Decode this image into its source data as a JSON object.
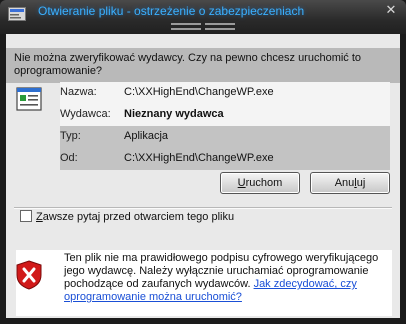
{
  "window": {
    "title": "Otwieranie pliku - ostrzeżenie o zabezpieczeniach",
    "close_label": "✕"
  },
  "question": "Nie można zweryfikować wydawcy. Czy na pewno chcesz uruchomić to oprogramowanie?",
  "file_info": [
    {
      "label": "Nazwa:",
      "value": "C:\\XXHighEnd\\ChangeWP.exe"
    },
    {
      "label": "Wydawca:",
      "value": "Nieznany wydawca"
    },
    {
      "label": "Typ:",
      "value": "Aplikacja"
    },
    {
      "label": "Od:",
      "value": "C:\\XXHighEnd\\ChangeWP.exe"
    }
  ],
  "buttons": {
    "run_u": "U",
    "run_rest": "ruchom",
    "cancel_pre": "Anu",
    "cancel_u": "l",
    "cancel_rest": "uj"
  },
  "checkbox": {
    "label_u": "Z",
    "label_rest": "awsze pytaj przed otwarciem tego pliku",
    "checked": false
  },
  "warning": {
    "text": "Ten plik nie ma prawidłowego podpisu cyfrowego weryfikującego jego wydawcę. Należy wyłącznie uruchamiać oprogramowanie pochodzące od zaufanych wydawców. ",
    "link": "Jak zdecydować, czy oprogramowanie można uruchomić?"
  },
  "colors": {
    "title_text": "#3bb0ff",
    "link": "#1a4fd6",
    "shield": "#d11a1a"
  }
}
